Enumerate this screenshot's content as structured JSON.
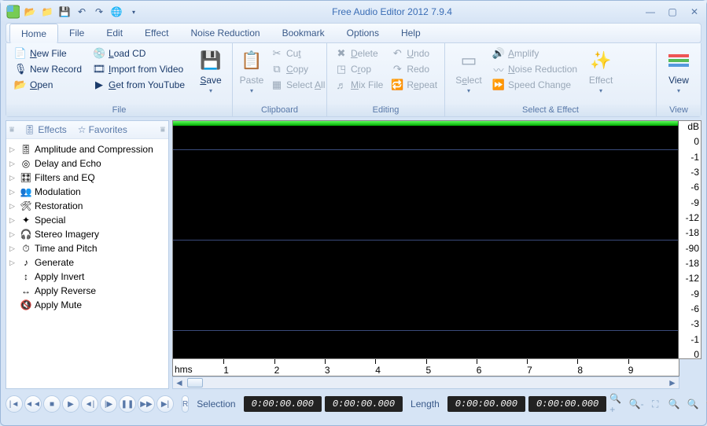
{
  "title": "Free Audio Editor 2012 7.9.4",
  "menu": {
    "home": "Home",
    "file": "File",
    "edit": "Edit",
    "effect": "Effect",
    "noise": "Noise Reduction",
    "bookmark": "Bookmark",
    "options": "Options",
    "help": "Help"
  },
  "ribbon": {
    "file": {
      "label": "File",
      "newfile": "New File",
      "newrecord": "New Record",
      "open": "Open",
      "loadcd": "Load CD",
      "importvideo": "Import from Video",
      "youtube": "Get from YouTube",
      "save": "Save"
    },
    "clipboard": {
      "label": "Clipboard",
      "paste": "Paste",
      "cut": "Cut",
      "copy": "Copy",
      "selectall": "Select All"
    },
    "editing": {
      "label": "Editing",
      "delete": "Delete",
      "crop": "Crop",
      "mixfile": "Mix File",
      "undo": "Undo",
      "redo": "Redo",
      "repeat": "Repeat"
    },
    "selecteffect": {
      "label": "Select & Effect",
      "select": "Select",
      "amplify": "Amplify",
      "noisereduction": "Noise Reduction",
      "speedchange": "Speed Change",
      "effect": "Effect"
    },
    "view": {
      "label": "View",
      "view": "View"
    }
  },
  "side": {
    "effects_tab": "Effects",
    "favorites_tab": "Favorites",
    "items": [
      {
        "label": "Amplitude and Compression",
        "exp": true
      },
      {
        "label": "Delay and Echo",
        "exp": true
      },
      {
        "label": "Filters and EQ",
        "exp": true
      },
      {
        "label": "Modulation",
        "exp": true
      },
      {
        "label": "Restoration",
        "exp": true
      },
      {
        "label": "Special",
        "exp": true
      },
      {
        "label": "Stereo Imagery",
        "exp": true
      },
      {
        "label": "Time and Pitch",
        "exp": true
      },
      {
        "label": "Generate",
        "exp": true
      },
      {
        "label": "Apply Invert",
        "exp": false
      },
      {
        "label": "Apply Reverse",
        "exp": false
      },
      {
        "label": "Apply Mute",
        "exp": false
      }
    ]
  },
  "db_scale": [
    "dB",
    "0",
    "-1",
    "-3",
    "-6",
    "-9",
    "-12",
    "-18",
    "-90",
    "-18",
    "-12",
    "-9",
    "-6",
    "-3",
    "-1",
    "0"
  ],
  "time_ticks": [
    "1",
    "2",
    "3",
    "4",
    "5",
    "6",
    "7",
    "8",
    "9"
  ],
  "time_unit": "hms",
  "status": {
    "selection_label": "Selection",
    "length_label": "Length",
    "sel_start": "0:00:00.000",
    "sel_end": "0:00:00.000",
    "len_start": "0:00:00.000",
    "len_end": "0:00:00.000",
    "rec": "R"
  }
}
